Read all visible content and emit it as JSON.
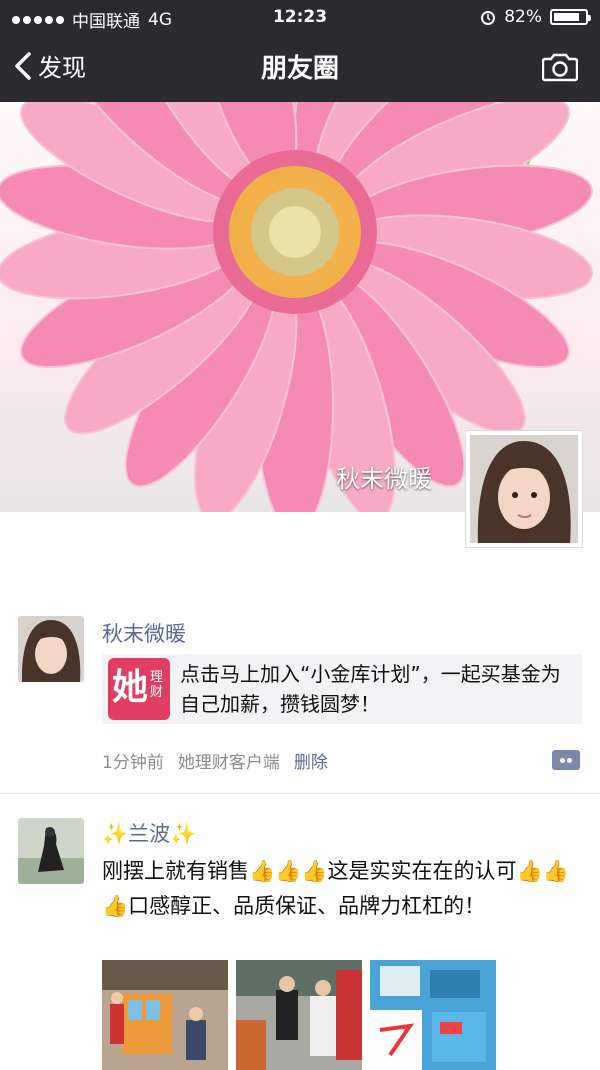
{
  "status": {
    "signal_dots": 5,
    "carrier": "中国联通",
    "network": "4G",
    "time": "12:23",
    "battery": "82%",
    "battery_level": 0.82
  },
  "nav": {
    "back_label": "发现",
    "title": "朋友圈",
    "camera_icon": "camera-icon"
  },
  "cover": {
    "owner_name": "秋末微暖"
  },
  "posts": [
    {
      "username": "秋末微暖",
      "link": {
        "icon_big": "她",
        "icon_small": "理财",
        "text": "点击马上加入“小金库计划”，一起买基金为自己加薪，攒钱圆梦！"
      },
      "time": "1分钟前",
      "source": "她理财客户端",
      "delete_label": "删除"
    },
    {
      "username": "✨兰波✨",
      "text": "刚摆上就有销售👍👍👍这是实实在在的认可👍👍👍口感醇正、品质保证、品牌力杠杠的！"
    }
  ],
  "colors": {
    "topbar": "#2b2a2f",
    "link_name": "#5a6a92",
    "app_icon": "#e13e64"
  }
}
